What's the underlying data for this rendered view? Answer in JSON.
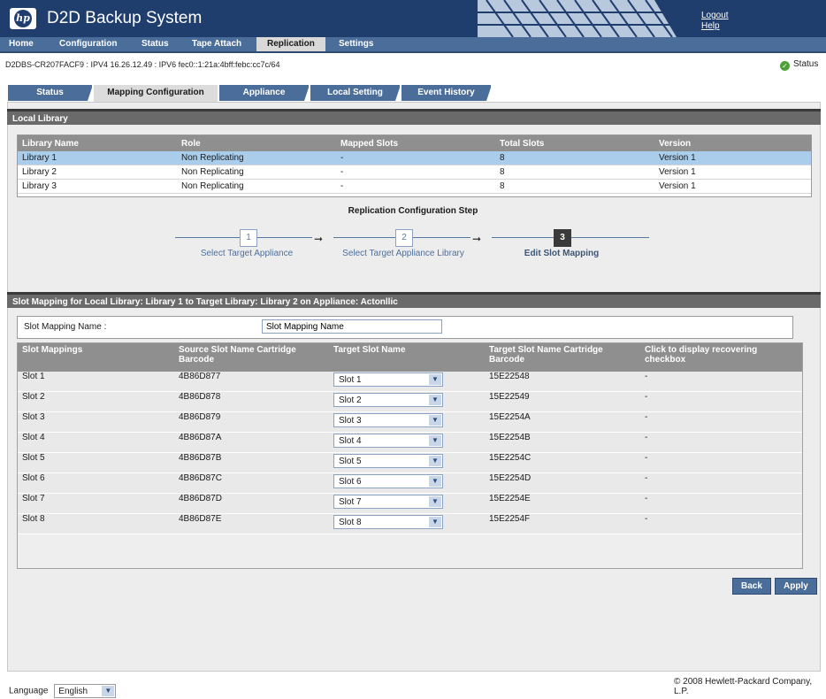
{
  "app": {
    "title": "D2D Backup System",
    "logo_text": "hp",
    "links": {
      "logout": "Logout",
      "help": "Help"
    }
  },
  "nav": [
    "Home",
    "Configuration",
    "Status",
    "Tape Attach",
    "Replication",
    "Settings"
  ],
  "nav_active": "Replication",
  "device_info": "D2DBS-CR207FACF9 : IPV4 16.26.12.49 : IPV6 fec0::1:21a:4bff:febc:cc7c/64",
  "status_label": "Status",
  "tabs": [
    "Status",
    "Mapping Configuration",
    "Appliance",
    "Local Setting",
    "Event History"
  ],
  "local_library": {
    "title": "Local Library",
    "columns": [
      "Library Name",
      "Role",
      "Mapped Slots",
      "Total Slots",
      "Version"
    ],
    "rows": [
      [
        "Library 1",
        "Non Replicating",
        "-",
        "8",
        "Version 1"
      ],
      [
        "Library 2",
        "Non Replicating",
        "-",
        "8",
        "Version 1"
      ],
      [
        "Library 3",
        "Non Replicating",
        "-",
        "8",
        "Version 1"
      ]
    ]
  },
  "steps": {
    "title": "Replication Configuration Step",
    "items": [
      {
        "num": "1",
        "label": "Select Target Appliance"
      },
      {
        "num": "2",
        "label": "Select Target Appliance Library"
      },
      {
        "num": "3",
        "label": "Edit Slot Mapping"
      }
    ]
  },
  "slot_mapping": {
    "title": "Slot Mapping for Local Library: Library 1 to Target Library: Library 2 on Appliance: Actonllic",
    "name_label": "Slot Mapping Name :",
    "name_value": "Slot Mapping Name",
    "columns": [
      "Slot Mappings",
      "Source Slot Name Cartridge Barcode",
      "Target Slot Name",
      "Target Slot Name Cartridge Barcode",
      "Click to display recovering checkbox"
    ],
    "rows": [
      {
        "slot": "Slot 1",
        "source": "4B86D877",
        "target": "Slot 1",
        "target_barcode": "15E22548",
        "recover": "-"
      },
      {
        "slot": "Slot 2",
        "source": "4B86D878",
        "target": "Slot 2",
        "target_barcode": "15E22549",
        "recover": "-"
      },
      {
        "slot": "Slot 3",
        "source": "4B86D879",
        "target": "Slot 3",
        "target_barcode": "15E2254A",
        "recover": "-"
      },
      {
        "slot": "Slot 4",
        "source": "4B86D87A",
        "target": "Slot 4",
        "target_barcode": "15E2254B",
        "recover": "-"
      },
      {
        "slot": "Slot 5",
        "source": "4B86D87B",
        "target": "Slot 5",
        "target_barcode": "15E2254C",
        "recover": "-"
      },
      {
        "slot": "Slot 6",
        "source": "4B86D87C",
        "target": "Slot 6",
        "target_barcode": "15E2254D",
        "recover": "-"
      },
      {
        "slot": "Slot 7",
        "source": "4B86D87D",
        "target": "Slot 7",
        "target_barcode": "15E2254E",
        "recover": "-"
      },
      {
        "slot": "Slot 8",
        "source": "4B86D87E",
        "target": "Slot 8",
        "target_barcode": "15E2254F",
        "recover": "-"
      }
    ]
  },
  "buttons": {
    "back": "Back",
    "apply": "Apply"
  },
  "footer": {
    "language_label": "Language",
    "language_value": "English",
    "copyright": "© 2008 Hewlett-Packard Company, L.P."
  },
  "colors": {
    "header": "#1f3e6e",
    "nav": "#4a6d99",
    "section": "#6a6a6a",
    "selected_row": "#a9cdeb"
  }
}
